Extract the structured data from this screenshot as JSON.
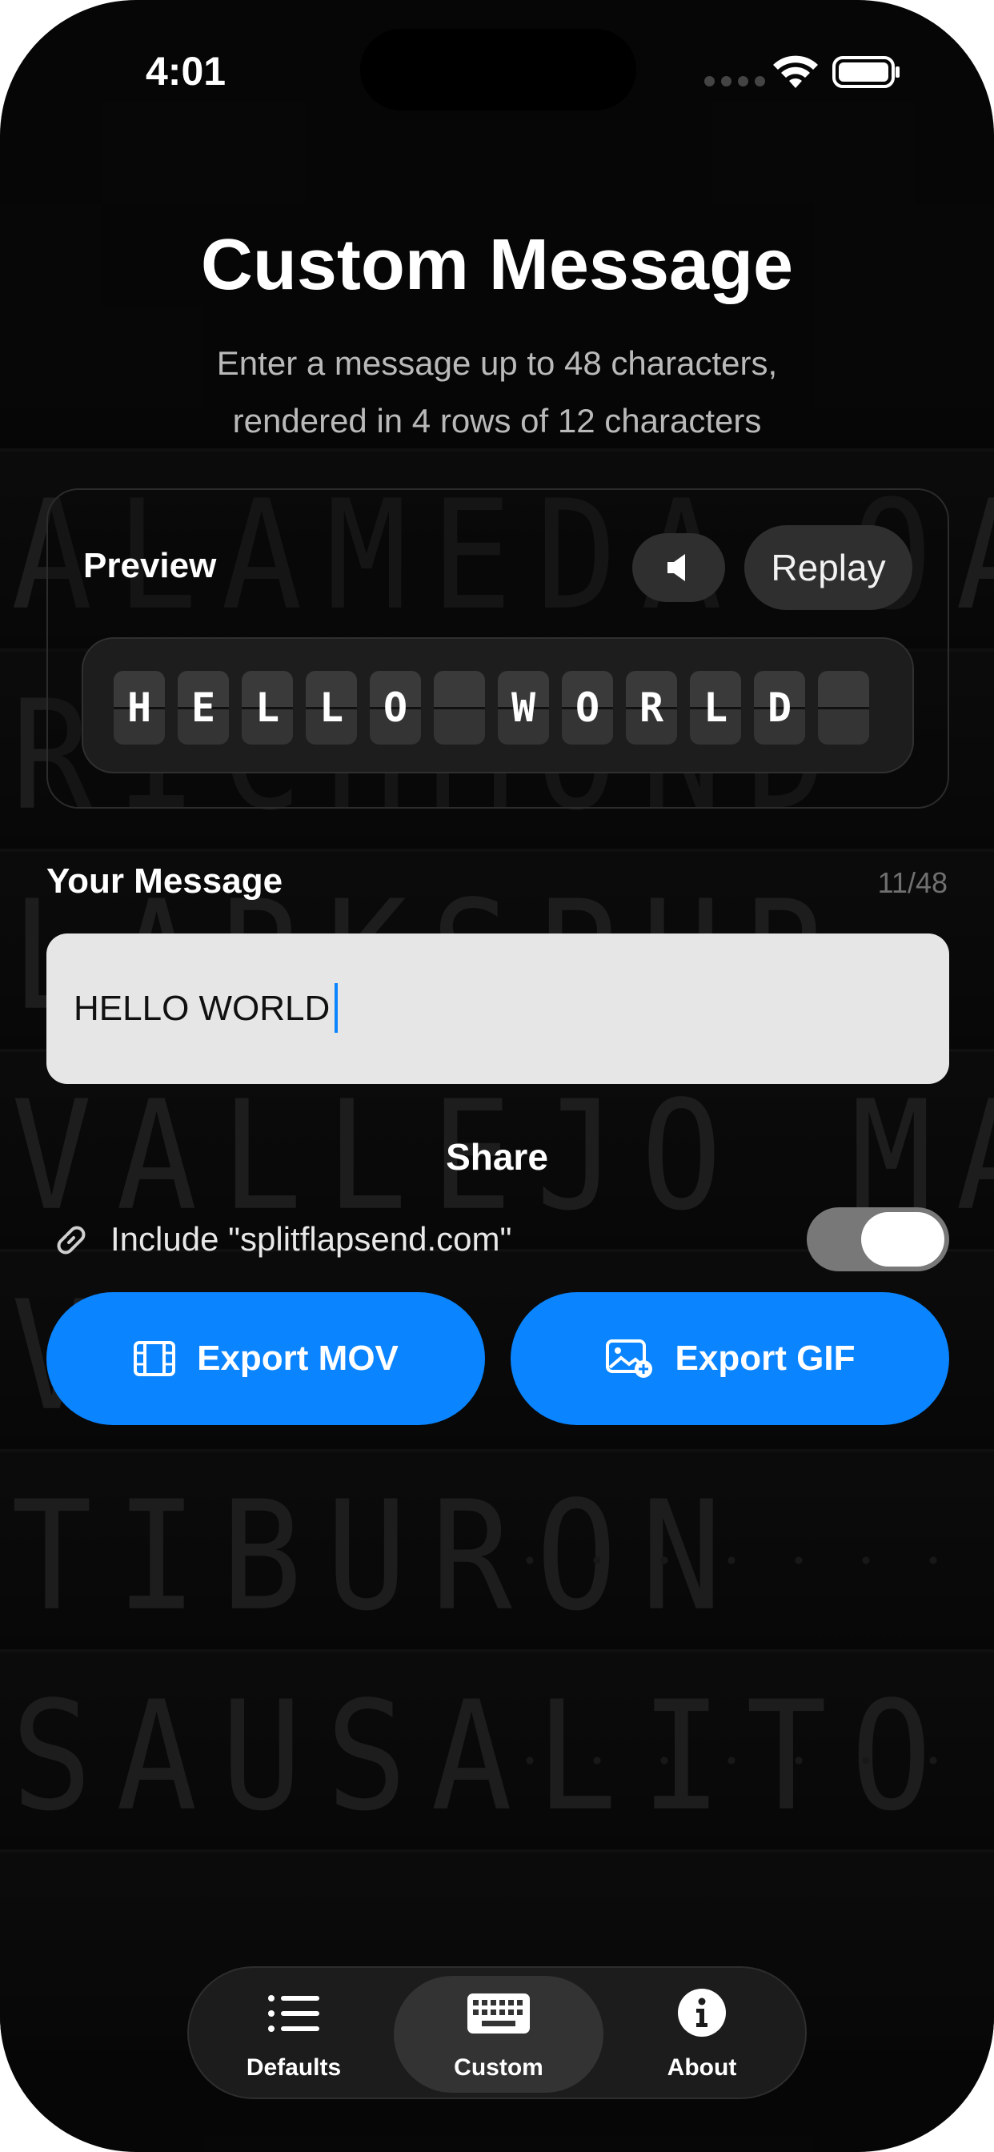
{
  "status_bar": {
    "time": "4:01"
  },
  "background_board": {
    "rows": [
      "ALAMEDA  OAKLAND",
      "RICHMOND",
      "LARKSPUR",
      "VALLEJO MARE IS",
      "V",
      "TIBURON",
      "SAUSALITO",
      ""
    ]
  },
  "header": {
    "title": "Custom Message",
    "subtitle_line1": "Enter a message up to 48 characters,",
    "subtitle_line2": "rendered in 4 rows of 12 characters"
  },
  "preview": {
    "label": "Preview",
    "mute_icon": "speaker-icon",
    "replay_label": "Replay",
    "flaps": [
      "H",
      "E",
      "L",
      "L",
      "O",
      "",
      "W",
      "O",
      "R",
      "L",
      "D",
      ""
    ]
  },
  "message": {
    "label": "Your Message",
    "count": "11/48",
    "value": "HELLO WORLD"
  },
  "share": {
    "label": "Share",
    "include_label": "Include \"splitflapsend.com\"",
    "include_enabled": true,
    "export_mov_label": "Export MOV",
    "export_gif_label": "Export GIF"
  },
  "tabs": [
    {
      "label": "Defaults",
      "icon": "list-icon",
      "active": false
    },
    {
      "label": "Custom",
      "icon": "keyboard-icon",
      "active": true
    },
    {
      "label": "About",
      "icon": "info-icon",
      "active": false
    }
  ],
  "colors": {
    "accent": "#0a84ff",
    "background": "#0a0a0a",
    "input_background": "#e6e6e6"
  }
}
